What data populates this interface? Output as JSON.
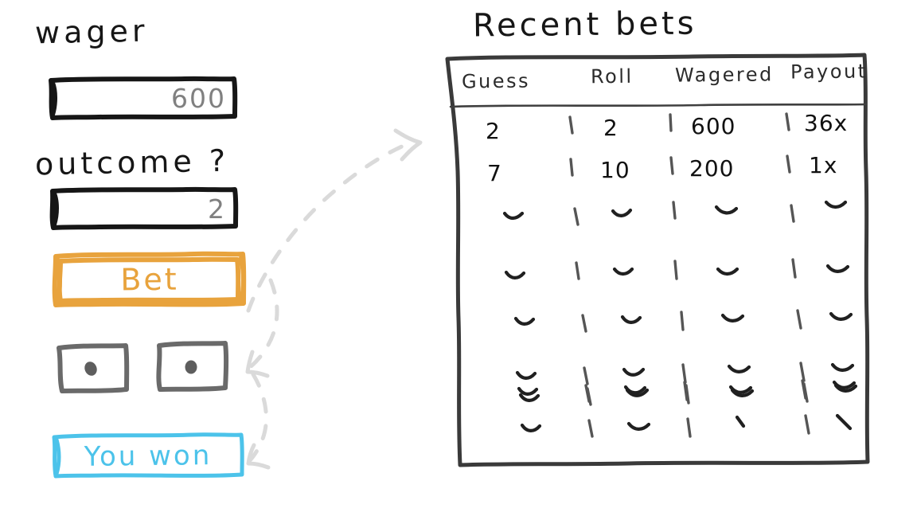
{
  "app": {
    "background_color": "#ffffff",
    "ink_color": "#161616",
    "accent_orange": "#e8a33d",
    "accent_cyan": "#4cc3ea",
    "dice_gray": "#6a6a6a",
    "arrow_gray": "#dadada",
    "value_gray": "#808080"
  },
  "left_panel": {
    "wager": {
      "label": "wager",
      "value": "600",
      "placeholder": "600"
    },
    "outcome": {
      "label": "outcome ?",
      "value": "2",
      "placeholder": "2"
    },
    "bet_button": {
      "label": "Bet",
      "color": "#e8a33d"
    },
    "dice": [
      {
        "name": "die-one",
        "pips": 1
      },
      {
        "name": "die-two",
        "pips": 1
      }
    ],
    "result_badge": {
      "label": "You won",
      "color": "#4cc3ea"
    }
  },
  "right_panel": {
    "title": "Recent bets",
    "table": {
      "columns": [
        "Guess",
        "Roll",
        "Wagered",
        "Payout"
      ],
      "rows": [
        {
          "guess": "2",
          "roll": "2",
          "wagered": "600",
          "payout": "36x"
        },
        {
          "guess": "7",
          "roll": "10",
          "wagered": "200",
          "payout": "1x"
        }
      ],
      "placeholder_row_count": 7
    }
  },
  "annotations": {
    "arrow_to_table": "arrow pointing from outcome input up-right to recent bets table",
    "arrow_to_dice": "arrow pointing left to the dice",
    "arrow_to_result": "arrow pointing left to the you won badge"
  }
}
